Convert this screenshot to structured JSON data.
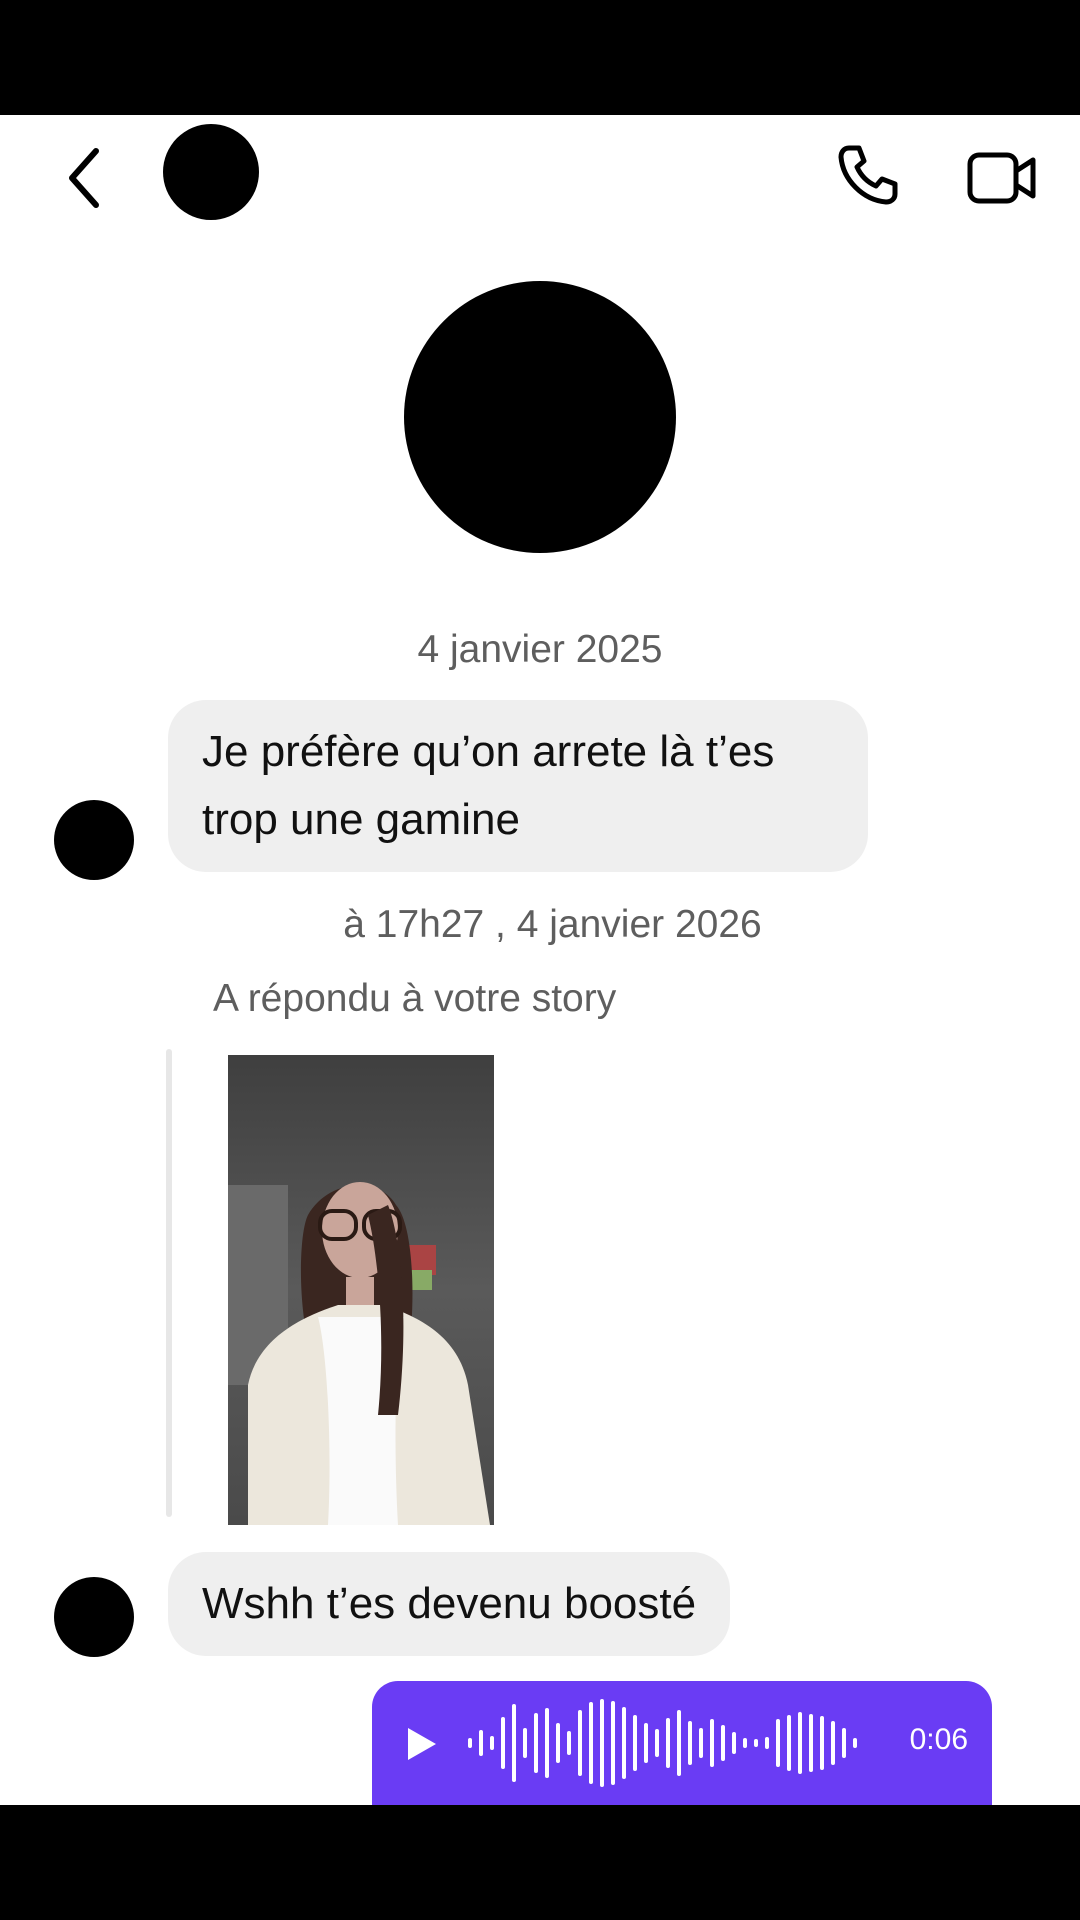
{
  "header": {
    "back_icon": "chevron-left-icon",
    "call_icon": "phone-icon",
    "video_icon": "video-camera-icon"
  },
  "messages": {
    "date_separator": "4 janvier 2025",
    "first_text_lines": [
      "Je préfère qu’on arrete là t’es",
      "trop une gamine"
    ],
    "timestamp": "à 17h27 , 4 janvier 2026",
    "story_reply_label": "A répondu à votre story",
    "second_text": "Wshh t’es devenu boosté",
    "voice": {
      "duration": "0:06",
      "play_icon": "play-icon",
      "bar_color": "#6a3cf4"
    }
  }
}
